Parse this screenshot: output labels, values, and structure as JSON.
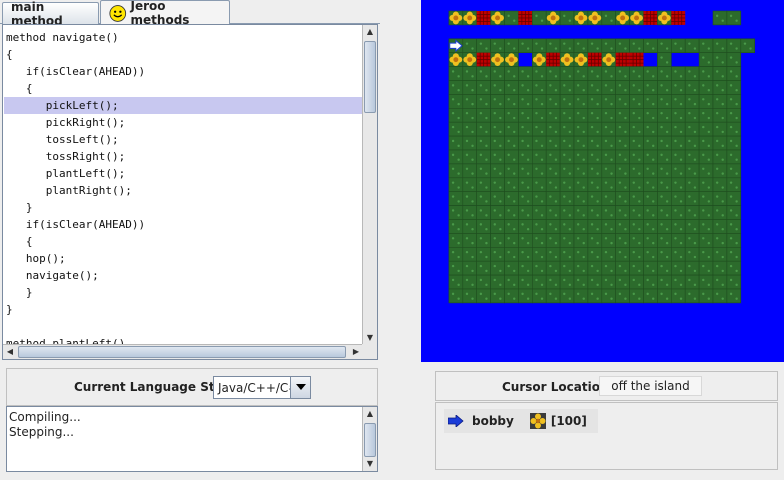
{
  "tabs": [
    {
      "label": "main method",
      "active": false
    },
    {
      "label": "Jeroo methods",
      "active": true,
      "icon": "smiley-icon"
    }
  ],
  "editor": {
    "highlight_line": 4,
    "lines": [
      "method navigate()",
      "{",
      "   if(isClear(AHEAD))",
      "   {",
      "      pickLeft();",
      "      pickRight();",
      "      tossLeft();",
      "      tossRight();",
      "      plantLeft();",
      "      plantRight();",
      "   }",
      "   if(isClear(AHEAD))",
      "   {",
      "   hop();",
      "   navigate();",
      "   }",
      "}",
      "",
      "method plantLeft()"
    ]
  },
  "language": {
    "label": "Current Language Style",
    "selected": "Java/C++/C#"
  },
  "console": {
    "lines": [
      "Compiling...",
      "Stepping..."
    ]
  },
  "cursor": {
    "label": "Cursor Location",
    "value": "off the island"
  },
  "jeroo": {
    "name": "bobby",
    "flowers": "[100]",
    "direction": "east"
  },
  "island": {
    "cols": 23,
    "rows": 23,
    "colors": {
      "water": "#0000ff",
      "grass": "#2c6b2c",
      "net": "#c00000",
      "flower": "#f0c020"
    },
    "legend": "W=water G=grass F=flower N=net J=jeroo",
    "grid": [
      "WFFNFGNGFGFFGFFNFNWWGGW",
      "WWWWWWWWWWWWWWWWWWWWWWW",
      "WJGGGGGGGGGGGGGGGGGGGGG",
      "WFFNFFWFNFFNFNNWGWWGGGW",
      "WGGGGGGGGGGGGGGGGGGGGGW",
      "WGGGGGGGGGGGGGGGGGGGGGW",
      "WGGGGGGGGGGGGGGGGGGGGGW",
      "WGGGGGGGGGGGGGGGGGGGGGW",
      "WGGGGGGGGGGGGGGGGGGGGGW",
      "WGGGGGGGGGGGGGGGGGGGGGW",
      "WGGGGGGGGGGGGGGGGGGGGGW",
      "WGGGGGGGGGGGGGGGGGGGGGW",
      "WGGGGGGGGGGGGGGGGGGGGGW",
      "WGGGGGGGGGGGGGGGGGGGGGW",
      "WGGGGGGGGGGGGGGGGGGGGGW",
      "WGGGGGGGGGGGGGGGGGGGGGW",
      "WGGGGGGGGGGGGGGGGGGGGGW",
      "WGGGGGGGGGGGGGGGGGGGGGW",
      "WGGGGGGGGGGGGGGGGGGGGGW",
      "WGGGGGGGGGGGGGGGGGGGGGW",
      "WGGGGGGGGGGGGGGGGGGGGGW",
      "WWWWWWWWWWWWWWWWWWWWWWW",
      "WWWWWWWWWWWWWWWWWWWWWWW"
    ]
  }
}
